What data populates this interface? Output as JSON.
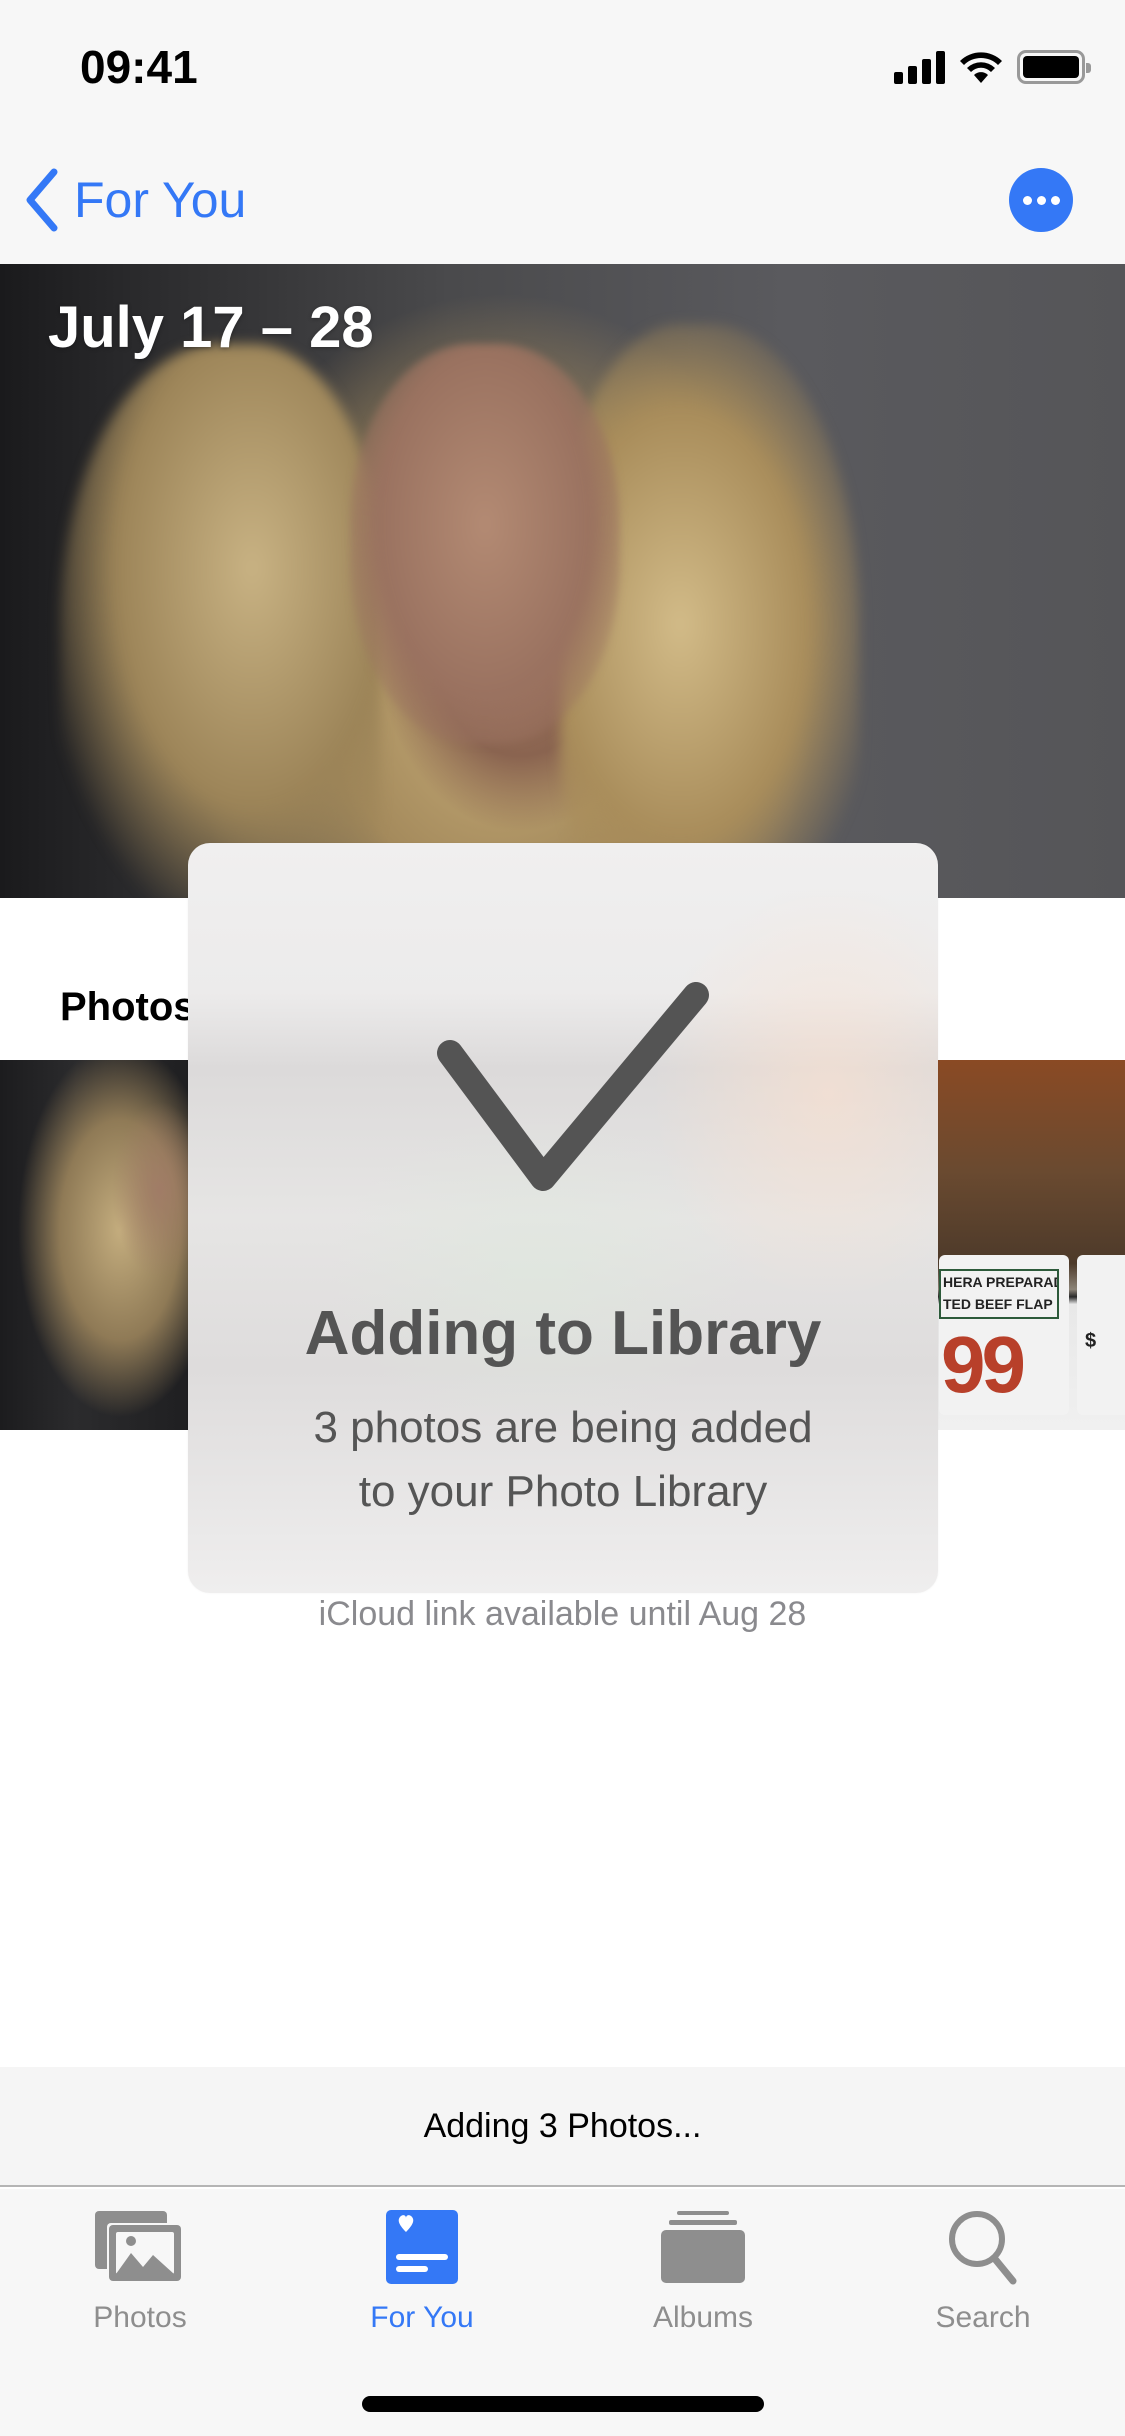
{
  "status_bar": {
    "time": "09:41",
    "icons": [
      "cellular-signal-icon",
      "wifi-icon",
      "battery-icon"
    ]
  },
  "nav": {
    "back_label": "For You",
    "back_icon": "chevron-left-icon",
    "more_icon": "ellipsis-circle-icon",
    "accent_color": "#3478f6"
  },
  "hero": {
    "title": "July 17 – 28"
  },
  "section": {
    "label": "Photos",
    "thumb_right_sign": {
      "line1": "HERA PREPARADA",
      "line2": "TED BEEF FLAP MEAT",
      "price": "99",
      "currency": "$"
    }
  },
  "hud": {
    "icon": "checkmark-icon",
    "title": "Adding to Library",
    "message_line1": "3 photos are being added",
    "message_line2": "to your Photo Library"
  },
  "icloud_note": "iCloud link available until Aug 28",
  "bottom_status": "Adding 3 Photos...",
  "tab_bar": {
    "tabs": [
      {
        "label": "Photos",
        "icon": "photos-icon",
        "active": false
      },
      {
        "label": "For You",
        "icon": "for-you-icon",
        "active": true
      },
      {
        "label": "Albums",
        "icon": "albums-icon",
        "active": false
      },
      {
        "label": "Search",
        "icon": "search-icon",
        "active": false
      }
    ],
    "active_color": "#3478f6",
    "inactive_color": "#8e8e8e"
  }
}
